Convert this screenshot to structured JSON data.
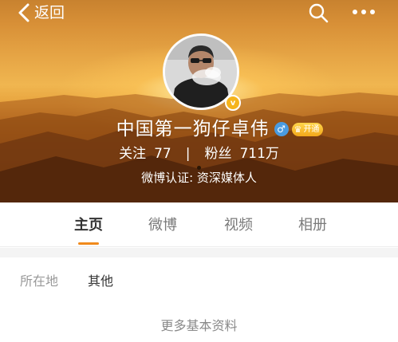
{
  "topbar": {
    "back_label": "返回",
    "back_icon": "chevron-left-icon",
    "search_icon": "search-icon",
    "more_icon": "more-dots-icon"
  },
  "profile": {
    "avatar_icon": "avatar-photo",
    "verified_badge": "v",
    "name": "中国第一狗仔卓伟",
    "gender_symbol": "♂",
    "vip_crown": "♛",
    "vip_label": "开通",
    "following_label": "关注",
    "following_count": "77",
    "divider": "|",
    "followers_label": "粉丝",
    "followers_count": "711万",
    "certification": "微博认证: 资深媒体人"
  },
  "tabs": [
    {
      "label": "主页",
      "active": true
    },
    {
      "label": "微博",
      "active": false
    },
    {
      "label": "视频",
      "active": false
    },
    {
      "label": "相册",
      "active": false
    }
  ],
  "info": {
    "location_label": "所在地",
    "location_value": "其他",
    "more_label": "更多基本资料"
  },
  "colors": {
    "accent": "#f08a1c",
    "header_glow": "#f0b650",
    "gender_blue": "#4a9be0",
    "vip_gold": "#f2a81b"
  }
}
